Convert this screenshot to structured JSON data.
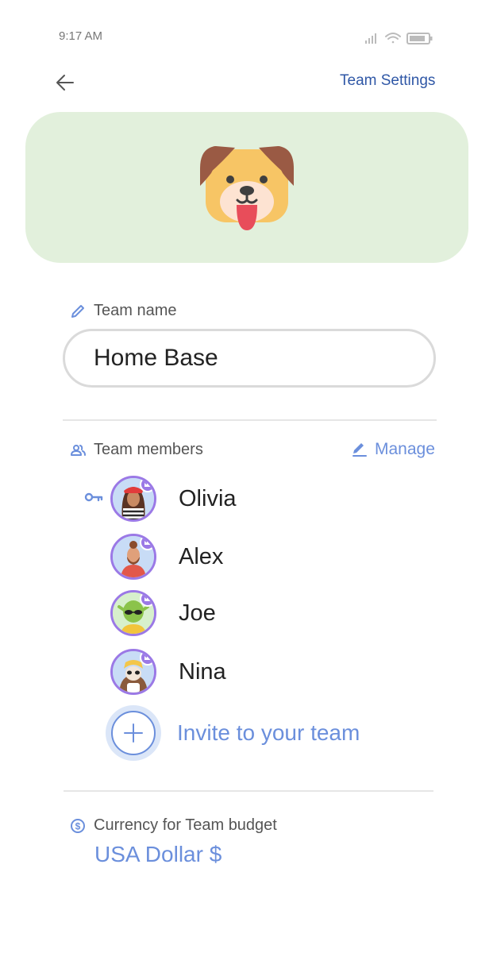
{
  "status_bar": {
    "time": "9:17 AM"
  },
  "header": {
    "team_settings_label": "Team Settings"
  },
  "team_name": {
    "label": "Team name",
    "value": "Home Base"
  },
  "members": {
    "label": "Team members",
    "manage_label": "Manage",
    "items": [
      {
        "name": "Olivia"
      },
      {
        "name": "Alex"
      },
      {
        "name": "Joe"
      },
      {
        "name": "Nina"
      }
    ],
    "invite_label": "Invite to your team"
  },
  "currency": {
    "label": "Currency for Team budget",
    "value": "USA Dollar $"
  },
  "colors": {
    "accent": "#6b8fdc",
    "link": "#2f57a6",
    "hero_bg": "#e2f0dc",
    "avatar_ring": "#9b79e6"
  },
  "icons": [
    "back-arrow-icon",
    "dog-icon",
    "pencil-icon",
    "people-icon",
    "edit-icon",
    "key-icon",
    "crown-icon",
    "plus-icon",
    "dollar-icon",
    "signal-icon",
    "wifi-icon",
    "battery-icon"
  ]
}
